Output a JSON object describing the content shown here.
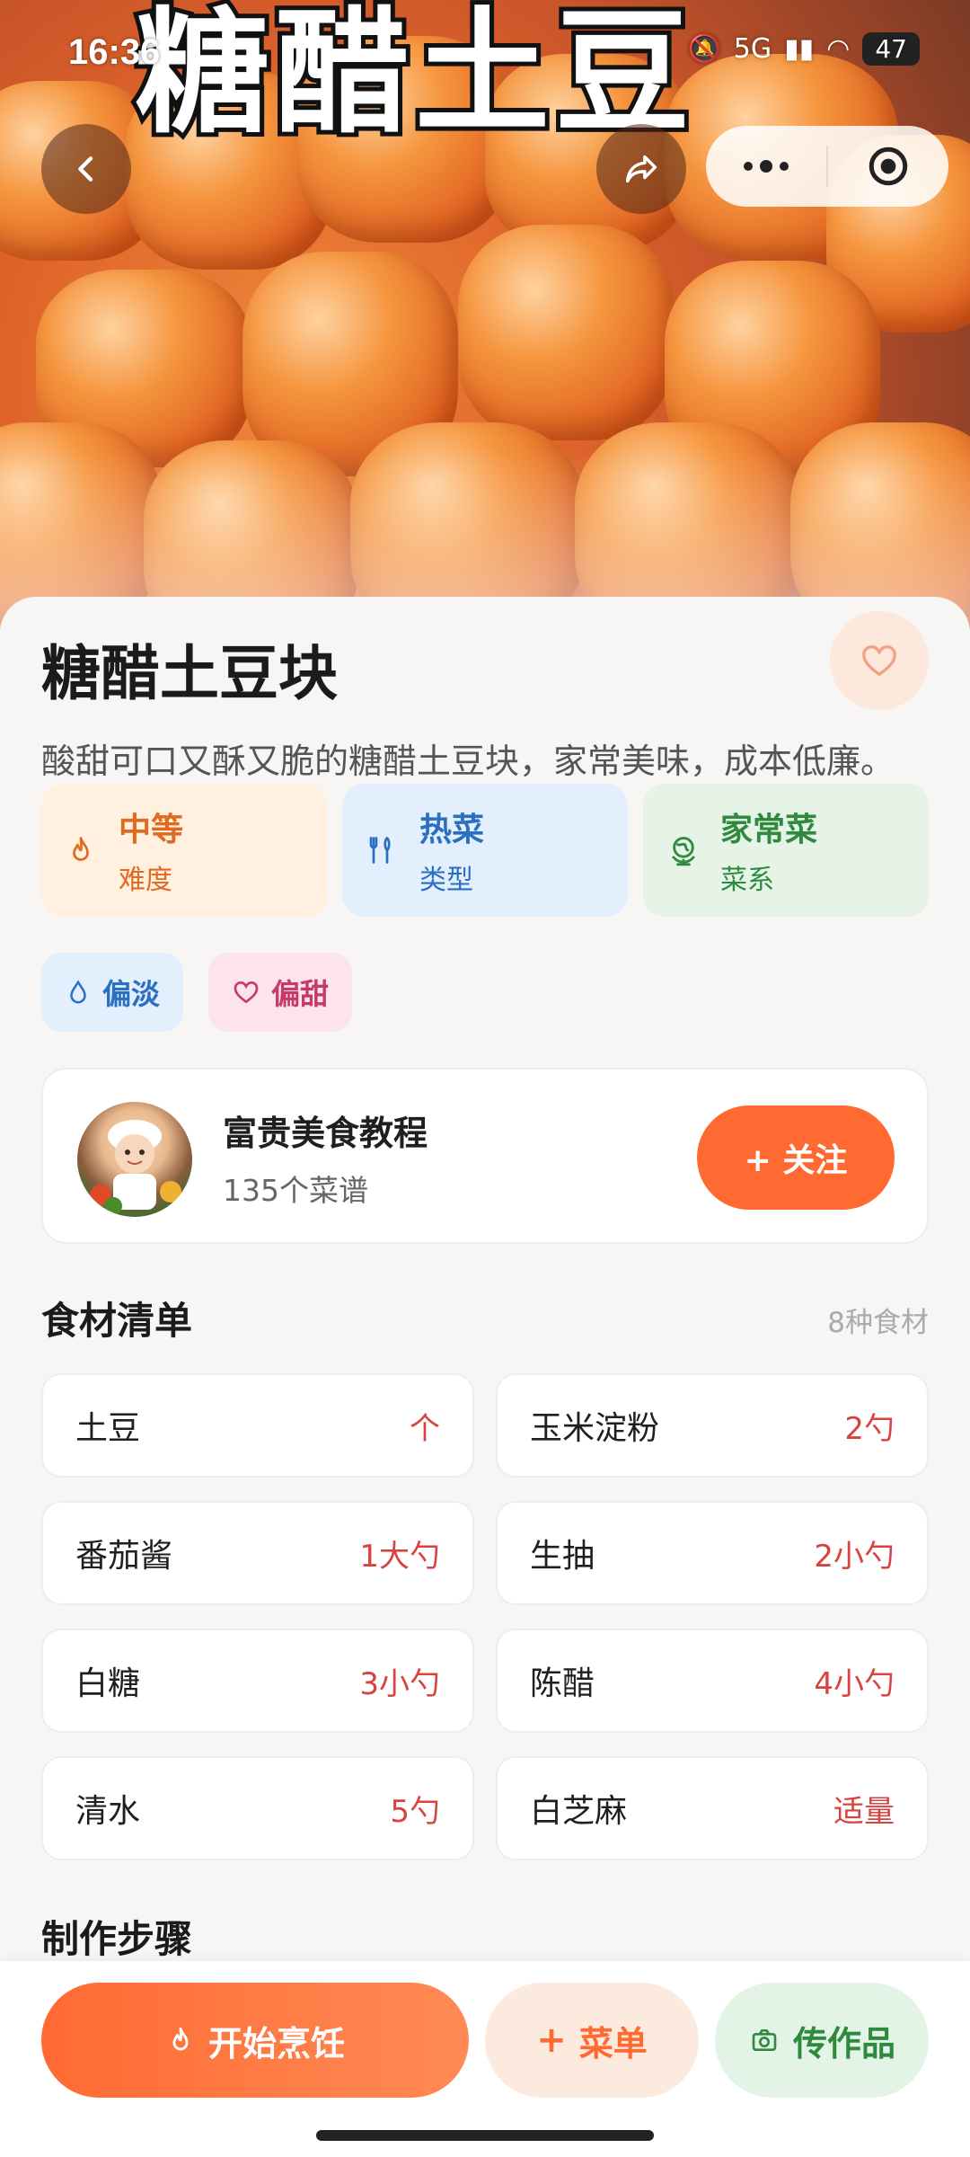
{
  "status_bar": {
    "time": "16:36",
    "network": "5G",
    "battery": "47"
  },
  "hero": {
    "overlay_title": "糖醋土豆",
    "image_desc": "glazed sweet and sour potato cubes with sesame"
  },
  "nav": {
    "back_icon": "chevron-left-icon",
    "share_icon": "share-arrow-icon",
    "more_icon": "more-dots-icon",
    "target_icon": "target-icon"
  },
  "recipe": {
    "title": "糖醋土豆块",
    "description": "酸甜可口又酥又脆的糖醋土豆块，家常美味，成本低廉。"
  },
  "info_cards": [
    {
      "value": "中等",
      "label": "难度",
      "icon": "flame-icon",
      "bg": "#fff0e0",
      "color": "#e06a1f"
    },
    {
      "value": "热菜",
      "label": "类型",
      "icon": "fork-knife-icon",
      "bg": "#e3effc",
      "color": "#2a6fc0"
    },
    {
      "value": "家常菜",
      "label": "菜系",
      "icon": "globe-icon",
      "bg": "#e5f4e6",
      "color": "#2f8a3f"
    }
  ],
  "tags": [
    {
      "label": "偏淡",
      "icon": "droplet-icon",
      "bg": "#e3effc",
      "color": "#2a6fc0"
    },
    {
      "label": "偏甜",
      "icon": "heart-icon",
      "bg": "#fde3ec",
      "color": "#c53a6c"
    }
  ],
  "author": {
    "name": "富贵美食教程",
    "recipe_count": "135个菜谱",
    "follow_label": "+ 关注"
  },
  "ingredients": {
    "title": "食材清单",
    "count": "8种食材",
    "items": [
      {
        "name": "土豆",
        "qty": "个"
      },
      {
        "name": "玉米淀粉",
        "qty": "2勺"
      },
      {
        "name": "番茄酱",
        "qty": "1大勺"
      },
      {
        "name": "生抽",
        "qty": "2小勺"
      },
      {
        "name": "白糖",
        "qty": "3小勺"
      },
      {
        "name": "陈醋",
        "qty": "4小勺"
      },
      {
        "name": "清水",
        "qty": "5勺"
      },
      {
        "name": "白芝麻",
        "qty": "适量"
      }
    ]
  },
  "steps": {
    "title": "制作步骤"
  },
  "bottom_bar": {
    "start_label": "开始烹饪",
    "menu_label": "菜单",
    "upload_label": "传作品"
  },
  "colors": {
    "accent": "#ff6a33",
    "price_red": "#d9433f"
  }
}
